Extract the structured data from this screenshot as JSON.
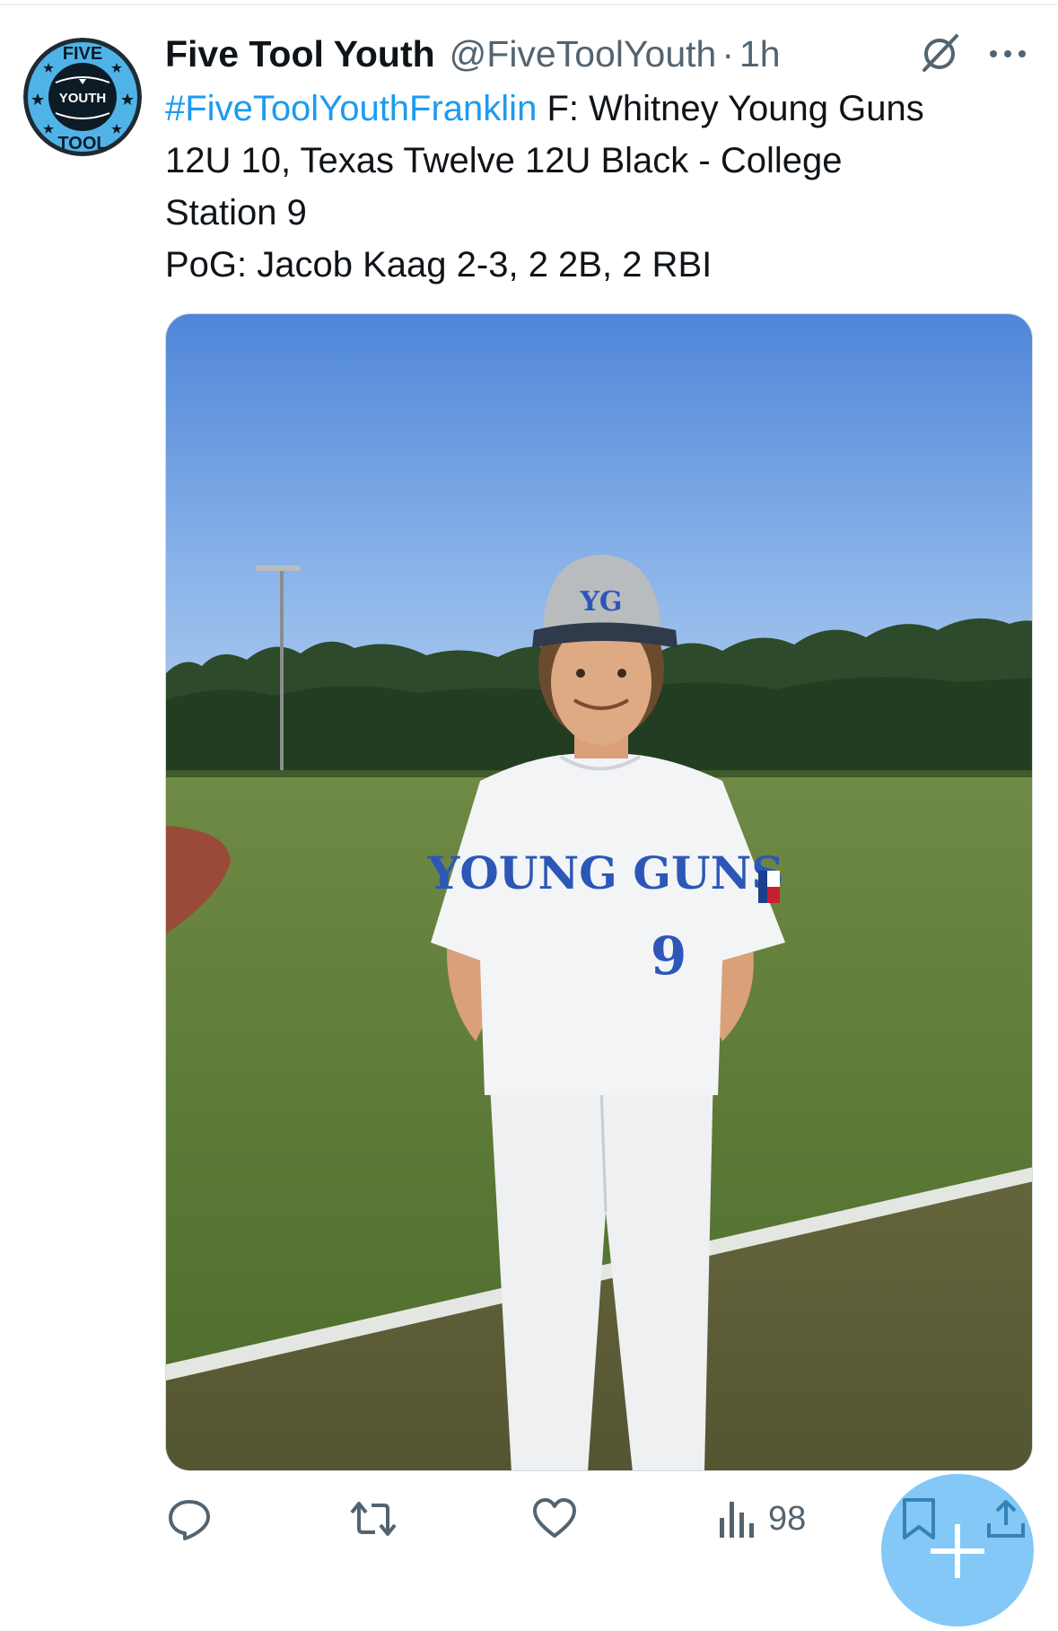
{
  "author": {
    "display_name": "Five Tool Youth",
    "handle": "@FiveToolYouth",
    "separator": "·",
    "time": "1h"
  },
  "avatar": {
    "icon": "five-tool-youth-logo",
    "text_top": "FIVE",
    "text_mid": "YOUTH",
    "text_bottom": "TOOL"
  },
  "tweet": {
    "hashtag": "#FiveToolYouthFranklin",
    "line1_rest": " F: Whitney Young Guns",
    "line2": "12U 10, Texas Twelve 12U Black - College",
    "line3": "Station 9",
    "line4": "PoG: Jacob Kaag 2-3, 2 2B, 2 RBI"
  },
  "media": {
    "jersey_text": "YOUNG GUNS",
    "jersey_number": "9",
    "cap_logo": "YG"
  },
  "actions": {
    "reply_icon": "reply-icon",
    "retweet_icon": "retweet-icon",
    "like_icon": "heart-icon",
    "views_icon": "views-icon",
    "views_count": "98",
    "bookmark_icon": "bookmark-icon",
    "share_icon": "share-icon"
  },
  "colors": {
    "accent": "#1d9bf0",
    "text": "#0f1419",
    "secondary": "#536471"
  }
}
